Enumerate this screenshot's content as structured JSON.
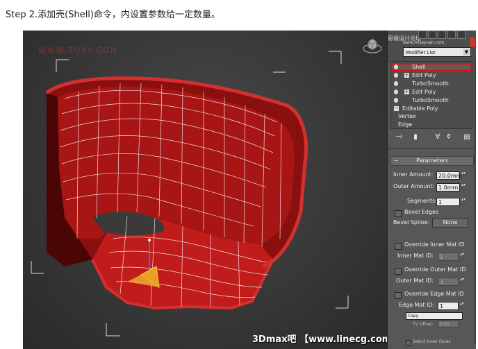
{
  "step_title": "Step 2.添加壳(Shell)命令，内设置参数给一定数量。",
  "watermark_top": "WWW.3OXY.COM",
  "watermark_bottom": "3Dmax吧 【www.linecg.com/tieba/1771】",
  "panel": {
    "top_logo": "思缘设计论坛",
    "top_site": "www.missyuan.com",
    "modifier_list": "Modifier List",
    "stack": [
      {
        "label": "Shell",
        "selected": true,
        "has_plus": false
      },
      {
        "label": "Edit Poly",
        "selected": false,
        "has_plus": true
      },
      {
        "label": "TurboSmooth",
        "selected": false,
        "has_plus": false
      },
      {
        "label": "Edit Poly",
        "selected": false,
        "has_plus": true
      },
      {
        "label": "TurboSmooth",
        "selected": false,
        "has_plus": false
      }
    ],
    "editable_poly": "Editable Poly",
    "sub_vertex": "Vertex",
    "sub_edge": "Edge",
    "parameters_title": "Parameters",
    "inner_amount_label": "Inner Amount:",
    "inner_amount_value": "20.0mm",
    "outer_amount_label": "Outer Amount:",
    "outer_amount_value": "1.0mm",
    "segments_label": "Segments:",
    "segments_value": "1",
    "bevel_edges_label": "Bevel Edges",
    "bevel_spline_label": "Bevel Spline:",
    "bevel_spline_value": "None",
    "override_inner_label": "Override Inner Mat ID",
    "inner_mat_label": "Inner Mat ID:",
    "inner_mat_value": "1",
    "override_outer_label": "Override Outer Mat ID",
    "outer_mat_label": "Outer Mat ID:",
    "outer_mat_value": "3",
    "override_edge_label": "Override Edge Mat ID",
    "edge_mat_label": "Edge Mat ID:",
    "edge_mat_value": "1",
    "copy_value": "Copy",
    "tv_offset_label": "TV Offset:",
    "tv_offset_value": "0.05",
    "select_inner_faces": "Select Inner Faces"
  },
  "colors": {
    "mesh_red": "#b01818",
    "mesh_dark": "#5a0808",
    "gizmo_orange": "#e8a020",
    "selection_red": "#d11111"
  }
}
